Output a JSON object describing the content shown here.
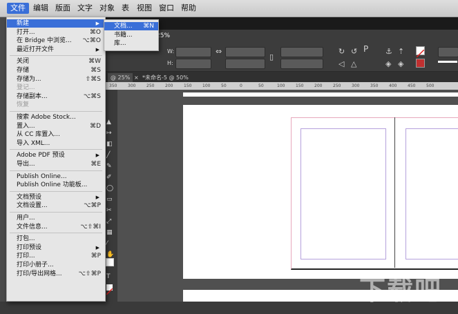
{
  "menubar": {
    "items": [
      "文件",
      "编辑",
      "版面",
      "文字",
      "对象",
      "表",
      "视图",
      "窗口",
      "帮助"
    ]
  },
  "control": {
    "zoom": "25%",
    "w_label": "W:",
    "h_label": "H:",
    "p_label": "P"
  },
  "tabs": [
    "@ 25%",
    "*未命名-5 @ 50%"
  ],
  "ruler": [
    "350",
    "300",
    "250",
    "200",
    "150",
    "100",
    "50",
    "0",
    "50",
    "100",
    "150",
    "200",
    "250",
    "300",
    "350",
    "400",
    "450",
    "500"
  ],
  "file_menu": {
    "items": [
      {
        "label": "新建",
        "shortcut": "",
        "arrow": true,
        "highlight": true
      },
      {
        "label": "打开...",
        "shortcut": "⌘O"
      },
      {
        "label": "在 Bridge 中浏览...",
        "shortcut": "⌥⌘O"
      },
      {
        "label": "最近打开文件",
        "shortcut": "",
        "arrow": true
      },
      {
        "sep": true
      },
      {
        "label": "关闭",
        "shortcut": "⌘W"
      },
      {
        "label": "存储",
        "shortcut": "⌘S"
      },
      {
        "label": "存储为...",
        "shortcut": "⇧⌘S"
      },
      {
        "label": "登记...",
        "shortcut": "",
        "disabled": true
      },
      {
        "label": "存储副本...",
        "shortcut": "⌥⌘S"
      },
      {
        "label": "恢复",
        "shortcut": "",
        "disabled": true
      },
      {
        "sep": true
      },
      {
        "label": "搜索 Adobe Stock...",
        "shortcut": ""
      },
      {
        "label": "置入...",
        "shortcut": "⌘D"
      },
      {
        "label": "从 CC 库置入...",
        "shortcut": ""
      },
      {
        "label": "导入 XML...",
        "shortcut": ""
      },
      {
        "sep": true
      },
      {
        "label": "Adobe PDF 预设",
        "shortcut": "",
        "arrow": true
      },
      {
        "label": "导出...",
        "shortcut": "⌘E"
      },
      {
        "sep": true
      },
      {
        "label": "Publish Online...",
        "shortcut": ""
      },
      {
        "label": "Publish Online 功能板...",
        "shortcut": ""
      },
      {
        "sep": true
      },
      {
        "label": "文档预设",
        "shortcut": "",
        "arrow": true
      },
      {
        "label": "文档设置...",
        "shortcut": "⌥⌘P"
      },
      {
        "sep": true
      },
      {
        "label": "用户...",
        "shortcut": ""
      },
      {
        "label": "文件信息...",
        "shortcut": "⌥⇧⌘I"
      },
      {
        "sep": true
      },
      {
        "label": "打包...",
        "shortcut": ""
      },
      {
        "label": "打印预设",
        "shortcut": "",
        "arrow": true
      },
      {
        "label": "打印...",
        "shortcut": "⌘P"
      },
      {
        "label": "打印小册子...",
        "shortcut": ""
      },
      {
        "label": "打印/导出网格...",
        "shortcut": "⌥⇧⌘P"
      }
    ]
  },
  "new_submenu": {
    "items": [
      {
        "label": "文档...",
        "shortcut": "⌘N",
        "highlight": true
      },
      {
        "label": "书籍...",
        "shortcut": ""
      },
      {
        "label": "库...",
        "shortcut": ""
      }
    ]
  },
  "watermark": "下载吧"
}
